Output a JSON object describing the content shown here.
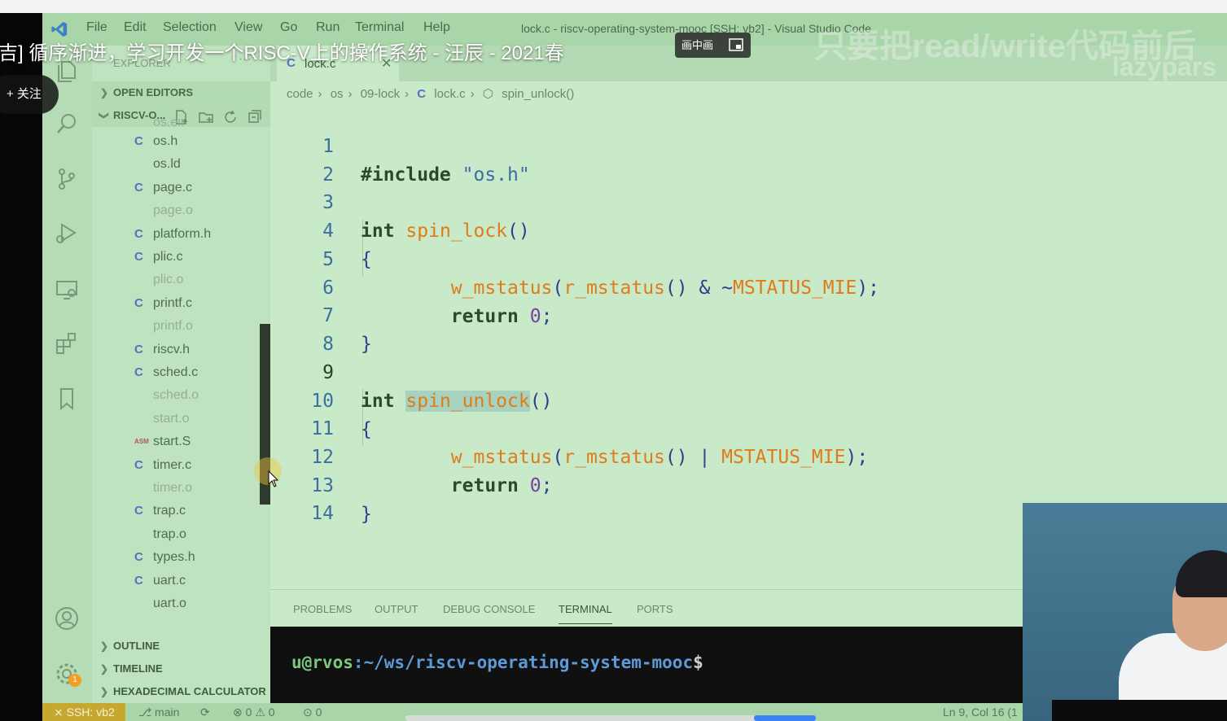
{
  "app": {
    "window_title": "lock.c - riscv-operating-system-mooc [SSH: vb2] - Visual Studio Code",
    "menu": [
      "File",
      "Edit",
      "Selection",
      "View",
      "Go",
      "Run",
      "Terminal",
      "Help"
    ]
  },
  "sidebar": {
    "explorer_label": "EXPLORER",
    "explorer_dots": "···",
    "open_editors": "OPEN EDITORS",
    "project": "RISCV-O...",
    "partial_top": "os.elf",
    "files": [
      {
        "icon": "C",
        "name": "os.h",
        "dim": false
      },
      {
        "icon": "",
        "name": "os.ld",
        "dim": false
      },
      {
        "icon": "C",
        "name": "page.c",
        "dim": false
      },
      {
        "icon": "",
        "name": "page.o",
        "dim": true
      },
      {
        "icon": "C",
        "name": "platform.h",
        "dim": false
      },
      {
        "icon": "C",
        "name": "plic.c",
        "dim": false
      },
      {
        "icon": "",
        "name": "plic.o",
        "dim": true
      },
      {
        "icon": "C",
        "name": "printf.c",
        "dim": false
      },
      {
        "icon": "",
        "name": "printf.o",
        "dim": true
      },
      {
        "icon": "C",
        "name": "riscv.h",
        "dim": false
      },
      {
        "icon": "C",
        "name": "sched.c",
        "dim": false
      },
      {
        "icon": "",
        "name": "sched.o",
        "dim": true
      },
      {
        "icon": "",
        "name": "start.o",
        "dim": true
      },
      {
        "icon": "ASM",
        "name": "start.S",
        "dim": false
      },
      {
        "icon": "C",
        "name": "timer.c",
        "dim": false
      },
      {
        "icon": "",
        "name": "timer.o",
        "dim": true
      },
      {
        "icon": "C",
        "name": "trap.c",
        "dim": false
      },
      {
        "icon": "",
        "name": "trap.o",
        "dim": false
      },
      {
        "icon": "C",
        "name": "types.h",
        "dim": false
      },
      {
        "icon": "C",
        "name": "uart.c",
        "dim": false
      },
      {
        "icon": "",
        "name": "uart.o",
        "dim": false
      }
    ],
    "outline": "OUTLINE",
    "timeline": "TIMELINE",
    "hex_calc": "HEXADECIMAL CALCULATOR"
  },
  "editor": {
    "tab_label": "lock.c",
    "breadcrumb": [
      "code",
      "os",
      "09-lock",
      "lock.c",
      "spin_unlock()"
    ],
    "line_numbers": [
      "1",
      "2",
      "3",
      "4",
      "5",
      "6",
      "7",
      "8",
      "9",
      "10",
      "11",
      "12",
      "13",
      "14"
    ],
    "code": {
      "l1_kw": "#include",
      "l1_str": "\"os.h\"",
      "l3_kw": "int",
      "l3_fn": "spin_lock",
      "l3_p": "()",
      "brace_open": "{",
      "brace_close": "}",
      "l5_fn1": "w_mstatus",
      "l5_p1": "(",
      "l5_fn2": "r_mstatus",
      "l5_p2": "()",
      "l5_op": " & ~",
      "l5_mac": "MSTATUS_MIE",
      "l5_end": ");",
      "return_kw": "return",
      "return_num": "0",
      "semicolon": ";",
      "l9_kw": "int",
      "l9_fn": "spin_unlock",
      "l9_p": "()",
      "l11_fn1": "w_mstatus",
      "l11_p1": "(",
      "l11_fn2": "r_mstatus",
      "l11_p2": "()",
      "l11_op": " | ",
      "l11_mac": "MSTATUS_MIE",
      "l11_end": ");"
    }
  },
  "panel": {
    "tabs": [
      "PROBLEMS",
      "OUTPUT",
      "DEBUG CONSOLE",
      "TERMINAL",
      "PORTS"
    ],
    "active_tab": "TERMINAL",
    "terminal_user": "u@rvos",
    "terminal_path": ":~/ws/riscv-operating-system-mooc",
    "terminal_prompt": "$"
  },
  "statusbar": {
    "remote": "SSH: vb2",
    "branch": "main",
    "errors": "0",
    "warnings": "0",
    "ports": "0",
    "cursor": "Ln 9, Col 16 (1",
    "notification_badge": "1"
  },
  "overlay": {
    "video_title": "吉] 循序渐进，学习开发一个RISC-V上的操作系统 - 汪辰 - 2021春",
    "follow": "+ 关注",
    "pip": "画中画",
    "watermark": "只要把read/write代码前后",
    "watermark_sub": "lazypars"
  },
  "colors": {
    "editor_bg": "#c8eac8",
    "keyword": "#2b4a2b",
    "function": "#e07b1a",
    "string": "#3a6ea5",
    "number": "#7a3fa0",
    "remote_badge": "#c6a830"
  }
}
